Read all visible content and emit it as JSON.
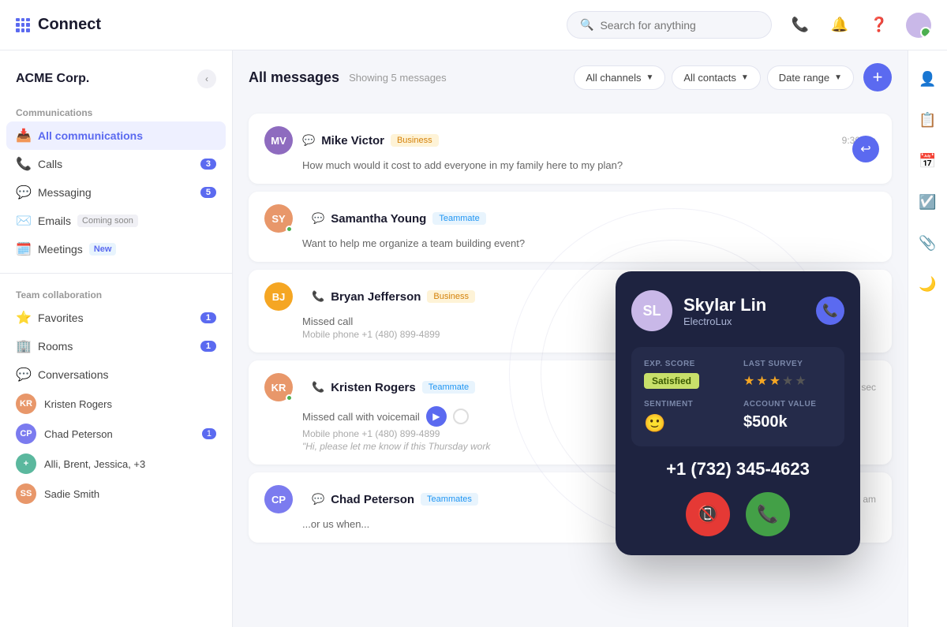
{
  "app": {
    "brand": "Connect",
    "grid_dots": true
  },
  "search": {
    "placeholder": "Search for anything"
  },
  "org": {
    "name": "ACME Corp."
  },
  "sidebar": {
    "communications_label": "Communications",
    "team_label": "Team collaboration",
    "nav_items": [
      {
        "id": "all-communications",
        "label": "All communications",
        "icon": "📥",
        "active": true
      },
      {
        "id": "calls",
        "label": "Calls",
        "icon": "📞",
        "badge": "3"
      },
      {
        "id": "messaging",
        "label": "Messaging",
        "icon": "💬",
        "badge": "5"
      },
      {
        "id": "emails",
        "label": "Emails",
        "icon": "✉️",
        "badge_text": "Coming soon"
      },
      {
        "id": "meetings",
        "label": "Meetings",
        "icon": "🗓️",
        "badge_new": "New"
      }
    ],
    "team_items": [
      {
        "id": "favorites",
        "label": "Favorites",
        "icon": "⭐",
        "badge": "1"
      },
      {
        "id": "rooms",
        "label": "Rooms",
        "icon": "🏠",
        "badge": "1"
      },
      {
        "id": "conversations",
        "label": "Conversations",
        "icon": "💬"
      }
    ],
    "contacts": [
      {
        "id": "kristen-rogers",
        "name": "Kristen Rogers",
        "color": "#e8976a"
      },
      {
        "id": "chad-peterson",
        "name": "Chad Peterson",
        "color": "#7b7bef",
        "badge": "1"
      },
      {
        "id": "multi",
        "name": "Alli, Brent, Jessica, +3",
        "color": "#5bb89e"
      },
      {
        "id": "sadie-smith",
        "name": "Sadie Smith",
        "color": "#e8976a"
      }
    ]
  },
  "messages": {
    "title": "All messages",
    "count_label": "Showing 5 messages",
    "filters": [
      {
        "label": "All channels",
        "has_arrow": true
      },
      {
        "label": "All contacts",
        "has_arrow": true
      },
      {
        "label": "Date range",
        "has_arrow": true
      }
    ],
    "add_button_label": "+",
    "items": [
      {
        "id": "mike-victor",
        "name": "Mike Victor",
        "tag": "Business",
        "tag_class": "tag-business",
        "avatar_initials": "MV",
        "avatar_color": "#8e6bbf",
        "channel_icon": "💬",
        "preview": "How much would it cost to add everyone in my family here to my plan?",
        "time": "9:30 am",
        "has_reply": true
      },
      {
        "id": "samantha-young",
        "name": "Samantha Young",
        "tag": "Teammate",
        "tag_class": "tag-teammate",
        "avatar_color": "#e8976a",
        "channel_icon": "💬",
        "preview": "Want to help me organize a team building event?",
        "time": "",
        "has_online": true
      },
      {
        "id": "bryan-jefferson",
        "name": "Bryan Jefferson",
        "tag": "Business",
        "tag_class": "tag-business",
        "avatar_initials": "BJ",
        "avatar_color": "#f5a623",
        "channel_icon": "📞",
        "preview": "Missed call",
        "sub": "Mobile phone +1 (480) 899-4899",
        "time": ""
      },
      {
        "id": "kristen-rogers",
        "name": "Kristen Rogers",
        "tag": "Teammate",
        "tag_class": "tag-teammate",
        "avatar_color": "#e8976a",
        "channel_icon": "📞",
        "preview": "Missed call with voicemail",
        "sub": "Mobile phone +1 (480) 899-4899",
        "quote": "\"Hi, please let me know if this Thursday work",
        "time": "15 sec",
        "has_voicemail": true,
        "has_online": true
      },
      {
        "id": "chad-peterson",
        "name": "Chad Peterson",
        "tag": "Teammates",
        "tag_class": "tag-teammates",
        "avatar_color": "#7b7bef",
        "channel_icon": "💬",
        "preview": "...or us when...",
        "time": "9:30 am"
      }
    ]
  },
  "call_card": {
    "name": "Skylar Lin",
    "company": "ElectroLux",
    "phone": "+1 (732) 345-4623",
    "exp_score_label": "EXP. SCORE",
    "last_survey_label": "LAST SURVEY",
    "sentiment_label": "SENTIMENT",
    "account_value_label": "ACCOUNT VALUE",
    "satisfaction": "Satisfied",
    "stars_filled": 3,
    "stars_total": 5,
    "sentiment_emoji": "🙂",
    "account_value": "$500k",
    "avatar_bg": "#c9b8e8"
  },
  "right_panel": {
    "icons": [
      "👤",
      "📋",
      "📅",
      "☑️",
      "📎",
      "🌙"
    ]
  },
  "colors": {
    "brand": "#5b6af0",
    "dark_bg": "#1e2340",
    "success": "#43a047",
    "danger": "#e53935"
  }
}
